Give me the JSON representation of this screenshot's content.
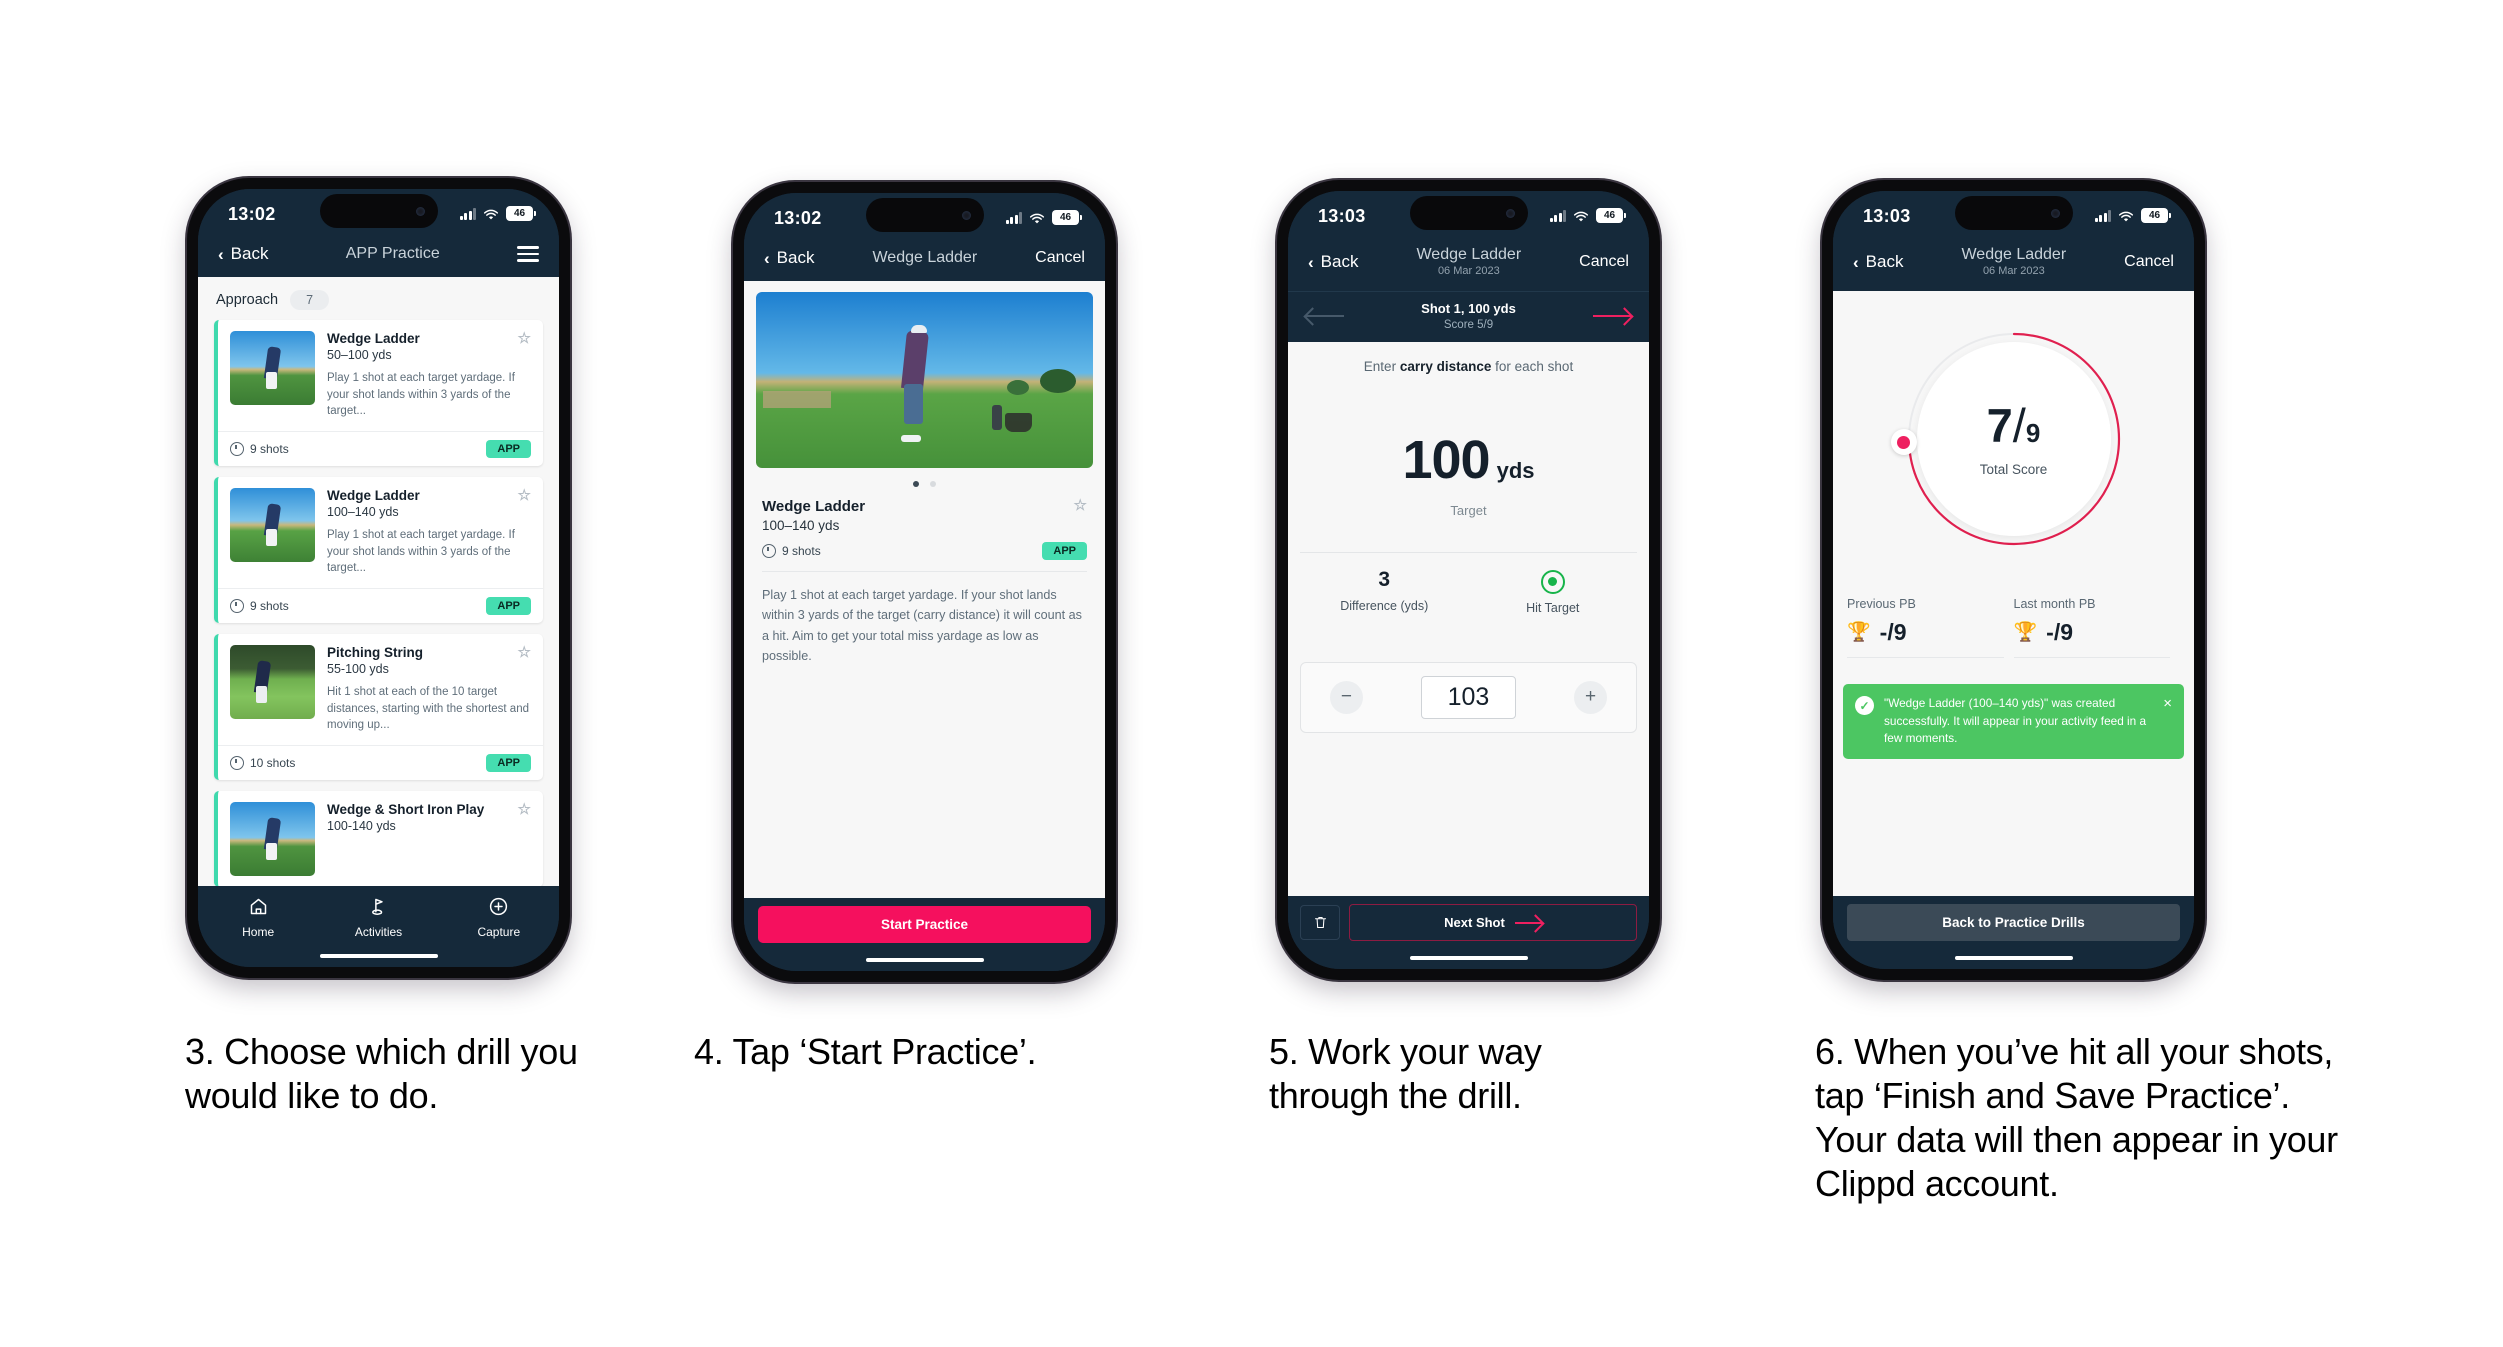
{
  "steps": [
    {
      "caption": "3. Choose which drill you would like to do.",
      "status": {
        "time": "13:02",
        "battery": "46"
      },
      "nav": {
        "back": "Back",
        "title": "APP Practice"
      },
      "section": {
        "label": "Approach",
        "count": "7"
      },
      "cards": [
        {
          "title": "Wedge Ladder",
          "yards": "50–100 yds",
          "desc": "Play 1 shot at each target yardage. If your shot lands within 3 yards of the target...",
          "shots": "9 shots",
          "badge": "APP"
        },
        {
          "title": "Wedge Ladder",
          "yards": "100–140 yds",
          "desc": "Play 1 shot at each target yardage. If your shot lands within 3 yards of the target...",
          "shots": "9 shots",
          "badge": "APP"
        },
        {
          "title": "Pitching String",
          "yards": "55-100 yds",
          "desc": "Hit 1 shot at each of the 10 target distances, starting with the shortest and moving up...",
          "shots": "10 shots",
          "badge": "APP"
        },
        {
          "title": "Wedge & Short Iron Play",
          "yards": "100-140 yds",
          "desc": "",
          "shots": "",
          "badge": ""
        }
      ],
      "tabs": [
        {
          "label": "Home",
          "icon": "home-icon"
        },
        {
          "label": "Activities",
          "icon": "golf-flag-icon"
        },
        {
          "label": "Capture",
          "icon": "plus-circle-icon"
        }
      ]
    },
    {
      "caption": "4. Tap ‘Start Practice’.",
      "status": {
        "time": "13:02",
        "battery": "46"
      },
      "nav": {
        "back": "Back",
        "title": "Wedge Ladder",
        "cancel": "Cancel"
      },
      "detail": {
        "title": "Wedge Ladder",
        "yards": "100–140 yds",
        "shots": "9 shots",
        "badge": "APP",
        "desc": "Play 1 shot at each target yardage. If your shot lands within 3 yards of the target (carry distance) it will count as a hit. Aim to get your total miss yardage as low as possible.",
        "cta": "Start Practice"
      }
    },
    {
      "caption": "5. Work your way through the drill.",
      "status": {
        "time": "13:03",
        "battery": "46"
      },
      "nav": {
        "back": "Back",
        "title": "Wedge Ladder",
        "subtitle": "06 Mar 2023",
        "cancel": "Cancel"
      },
      "shotbar": {
        "title": "Shot 1, 100 yds",
        "score": "Score 5/9"
      },
      "entry": {
        "prompt_pre": "Enter ",
        "prompt_bold": "carry distance",
        "prompt_post": " for each shot",
        "target_value": "100",
        "target_unit": "yds",
        "target_label": "Target",
        "difference_value": "3",
        "difference_label": "Difference (yds)",
        "hit_label": "Hit Target",
        "stepper_value": "103",
        "minus": "−",
        "plus": "+",
        "next": "Next Shot",
        "delete_icon": "trash-icon"
      }
    },
    {
      "caption": "6. When you’ve hit all your shots, tap ‘Finish and Save Practice’. Your data will then appear in your Clippd account.",
      "status": {
        "time": "13:03",
        "battery": "46"
      },
      "nav": {
        "back": "Back",
        "title": "Wedge Ladder",
        "subtitle": "06 Mar 2023",
        "cancel": "Cancel"
      },
      "result": {
        "score_num": "7",
        "score_slash": "/",
        "score_den": "9",
        "score_label": "Total Score",
        "pbs": [
          {
            "label": "Previous PB",
            "value": "-/9",
            "icon": "trophy-icon"
          },
          {
            "label": "Last month PB",
            "value": "-/9",
            "icon": "trophy-icon"
          }
        ],
        "toast": "\"Wedge Ladder (100–140 yds)\" was created successfully. It will appear in your activity feed in a few moments.",
        "toast_close": "×",
        "toast_check": "✓",
        "back_button": "Back to Practice Drills"
      }
    }
  ],
  "colors": {
    "nav_dark": "#15293a",
    "accent_pink": "#f5105e",
    "accent_teal": "#45ddb0",
    "toast_green": "#4cc662",
    "page_bg": "#ffffff"
  }
}
